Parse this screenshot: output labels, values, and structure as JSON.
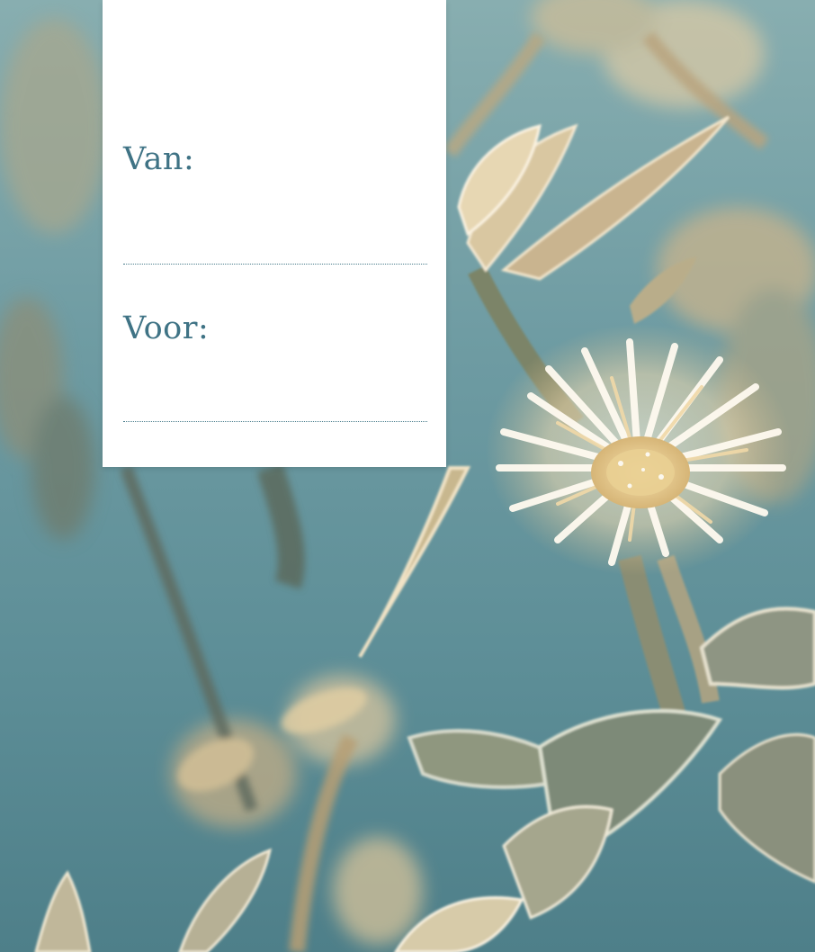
{
  "card": {
    "from_label": "Van:",
    "to_label": "Voor:"
  },
  "background": {
    "subject": "frost-covered-flower",
    "colors": {
      "sky": "#6f9ca3",
      "petal": "#fff4e2",
      "center": "#e8c98a",
      "leaf": "#b8b49a",
      "label_text": "#3f7385"
    }
  }
}
